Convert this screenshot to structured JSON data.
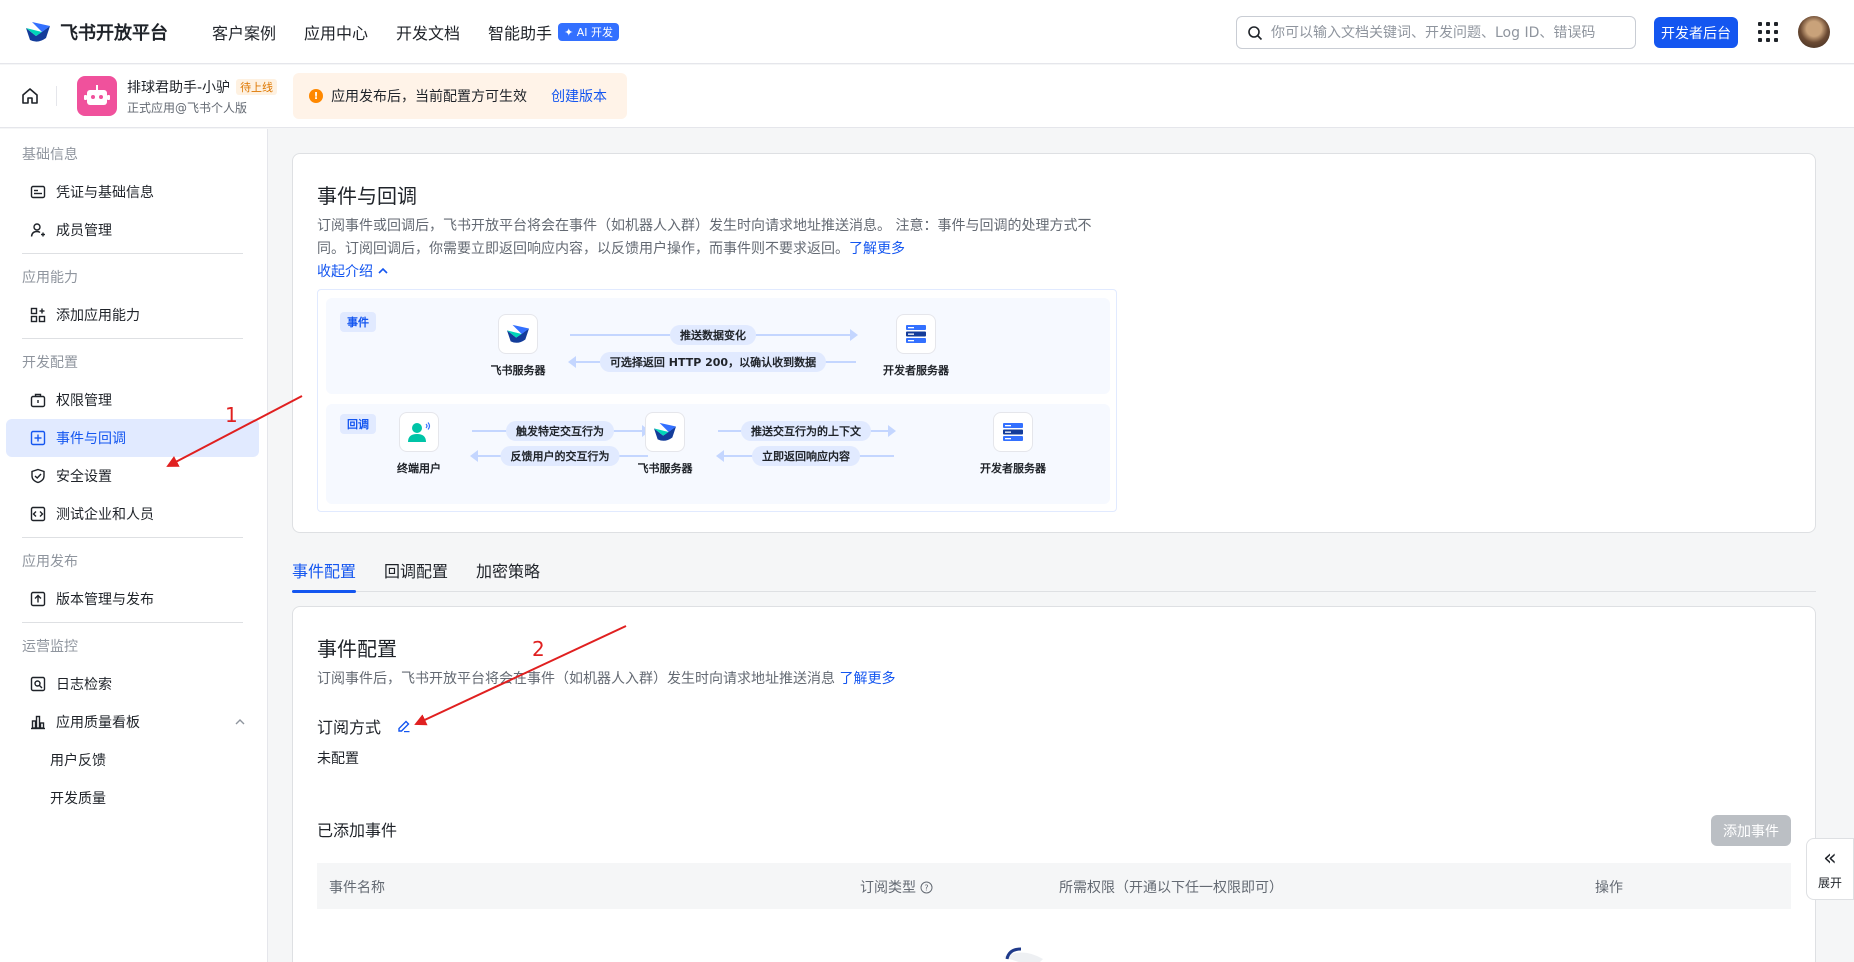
{
  "topbar": {
    "logo_text": "飞书开放平台",
    "nav": [
      "客户案例",
      "应用中心",
      "开发文档",
      "智能助手"
    ],
    "ai_badge": "✦ AI 开发",
    "search_placeholder": "你可以输入文档关键词、开发问题、Log ID、错误码",
    "dev_console": "开发者后台"
  },
  "app": {
    "name": "排球君助手-小驴",
    "status": "待上线",
    "subtitle": "正式应用@飞书个人版"
  },
  "notice": {
    "text": "应用发布后，当前配置方可生效",
    "action": "创建版本"
  },
  "sidebar": {
    "groups": [
      {
        "title": "基础信息",
        "items": [
          {
            "label": "凭证与基础信息",
            "icon": "credential-icon"
          },
          {
            "label": "成员管理",
            "icon": "member-icon"
          }
        ]
      },
      {
        "title": "应用能力",
        "items": [
          {
            "label": "添加应用能力",
            "icon": "add-capability-icon"
          }
        ]
      },
      {
        "title": "开发配置",
        "items": [
          {
            "label": "权限管理",
            "icon": "permission-icon"
          },
          {
            "label": "事件与回调",
            "icon": "event-icon"
          },
          {
            "label": "安全设置",
            "icon": "shield-icon"
          },
          {
            "label": "测试企业和人员",
            "icon": "test-icon"
          }
        ]
      },
      {
        "title": "应用发布",
        "items": [
          {
            "label": "版本管理与发布",
            "icon": "upload-icon"
          }
        ]
      },
      {
        "title": "运营监控",
        "items": [
          {
            "label": "日志检索",
            "icon": "log-icon"
          },
          {
            "label": "应用质量看板",
            "icon": "chart-icon"
          },
          {
            "label": "用户反馈",
            "icon": ""
          },
          {
            "label": "开发质量",
            "icon": ""
          }
        ]
      }
    ],
    "active": "事件与回调"
  },
  "intro": {
    "title": "事件与回调",
    "desc": "订阅事件或回调后，飞书开放平台将会在事件（如机器人入群）发生时向请求地址推送消息。 注意：事件与回调的处理方式不同。订阅回调后，你需要立即返回响应内容，以反馈用户操作，而事件则不要求返回。",
    "learn_more": "了解更多",
    "collapse": "收起介绍",
    "diagram": {
      "event_tag": "事件",
      "callback_tag": "回调",
      "feishu_server": "飞书服务器",
      "dev_server": "开发者服务器",
      "end_user": "终端用户",
      "push_change": "推送数据变化",
      "http200": "可选择返回 HTTP 200，以确认收到数据",
      "trigger": "触发特定交互行为",
      "feedback": "反馈用户的交互行为",
      "push_context": "推送交互行为的上下文",
      "return_now": "立即返回响应内容"
    }
  },
  "tabs": [
    "事件配置",
    "回调配置",
    "加密策略"
  ],
  "event_config": {
    "title": "事件配置",
    "desc": "订阅事件后，飞书开放平台将会在事件（如机器人入群）发生时向请求地址推送消息",
    "learn_more": "了解更多",
    "sub_label": "订阅方式",
    "sub_value": "未配置",
    "added_title": "已添加事件",
    "add_button": "添加事件",
    "columns": [
      "事件名称",
      "订阅类型",
      "所需权限（开通以下任一权限即可）",
      "操作"
    ]
  },
  "expand_label": "展开",
  "annotations": [
    "1",
    "2"
  ],
  "colors": {
    "accent": "#1456f0",
    "arrow": "#e02020",
    "warning": "#ff8800"
  }
}
